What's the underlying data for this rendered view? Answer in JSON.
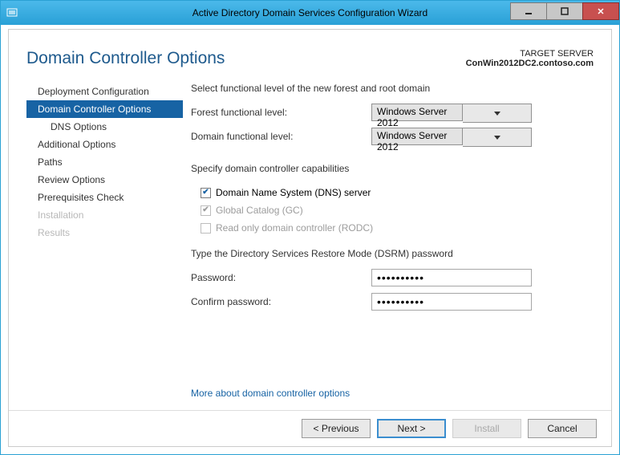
{
  "titlebar": {
    "title": "Active Directory Domain Services Configuration Wizard"
  },
  "header": {
    "page_title": "Domain Controller Options",
    "target_label": "TARGET SERVER",
    "target_value": "ConWin2012DC2.contoso.com"
  },
  "sidebar": {
    "items": [
      {
        "label": "Deployment Configuration",
        "state": "normal"
      },
      {
        "label": "Domain Controller Options",
        "state": "selected"
      },
      {
        "label": "DNS Options",
        "state": "sub"
      },
      {
        "label": "Additional Options",
        "state": "normal"
      },
      {
        "label": "Paths",
        "state": "normal"
      },
      {
        "label": "Review Options",
        "state": "normal"
      },
      {
        "label": "Prerequisites Check",
        "state": "normal"
      },
      {
        "label": "Installation",
        "state": "disabled"
      },
      {
        "label": "Results",
        "state": "disabled"
      }
    ]
  },
  "main": {
    "func_level_heading": "Select functional level of the new forest and root domain",
    "forest_label": "Forest functional level:",
    "forest_value": "Windows Server 2012",
    "domain_label": "Domain functional level:",
    "domain_value": "Windows Server 2012",
    "caps_heading": "Specify domain controller capabilities",
    "dns_label": "Domain Name System (DNS) server",
    "gc_label": "Global Catalog (GC)",
    "rodc_label": "Read only domain controller (RODC)",
    "dsrm_heading": "Type the Directory Services Restore Mode (DSRM) password",
    "pwd_label": "Password:",
    "pwd_value": "••••••••••",
    "confirm_label": "Confirm password:",
    "confirm_value": "••••••••••",
    "link": "More about domain controller options"
  },
  "footer": {
    "previous": "< Previous",
    "next": "Next >",
    "install": "Install",
    "cancel": "Cancel"
  }
}
